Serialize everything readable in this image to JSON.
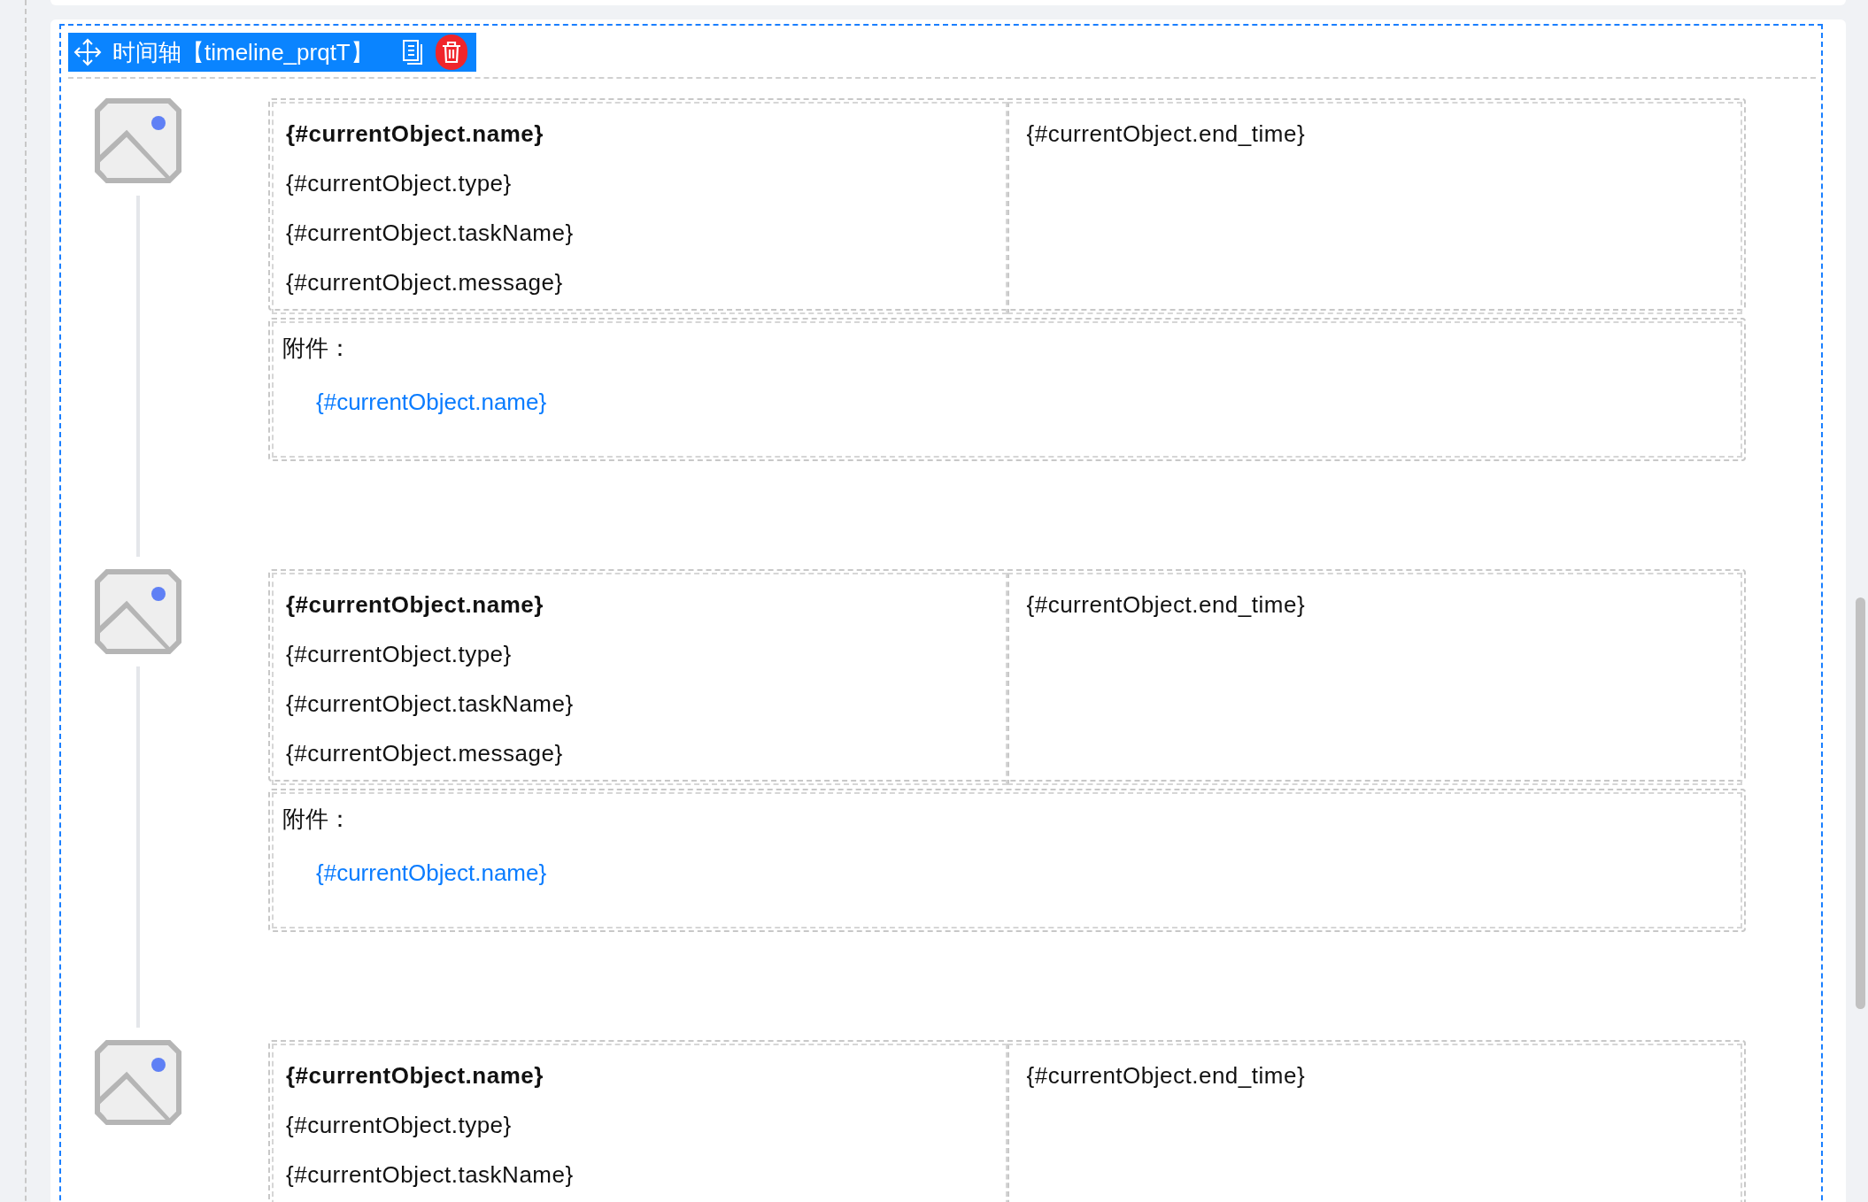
{
  "toolbar": {
    "title": "时间轴【timeline_prqtT】"
  },
  "items": [
    {
      "name": "{#currentObject.name}",
      "type": "{#currentObject.type}",
      "taskName": "{#currentObject.taskName}",
      "message": "{#currentObject.message}",
      "end_time": "{#currentObject.end_time}",
      "attachment": {
        "label": "附件：",
        "link": "{#currentObject.name}"
      }
    },
    {
      "name": "{#currentObject.name}",
      "type": "{#currentObject.type}",
      "taskName": "{#currentObject.taskName}",
      "message": "{#currentObject.message}",
      "end_time": "{#currentObject.end_time}",
      "attachment": {
        "label": "附件：",
        "link": "{#currentObject.name}"
      }
    },
    {
      "name": "{#currentObject.name}",
      "type": "{#currentObject.type}",
      "taskName": "{#currentObject.taskName}",
      "end_time": "{#currentObject.end_time}"
    }
  ]
}
